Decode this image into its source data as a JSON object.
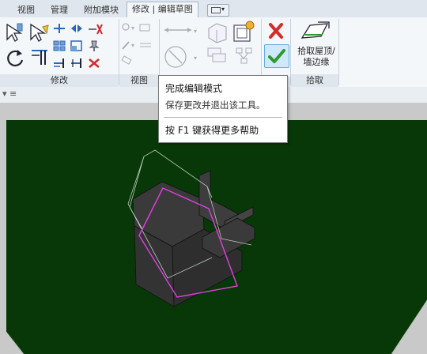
{
  "tabs": [
    {
      "label": "视图",
      "active": false
    },
    {
      "label": "管理",
      "active": false
    },
    {
      "label": "附加模块",
      "active": false
    },
    {
      "label": "修改 | 编辑草图",
      "active": true
    }
  ],
  "panels": {
    "modify": "修改",
    "view": "视图",
    "pick": "拾取"
  },
  "pick_roof_button": {
    "line1": "拾取屋顶/",
    "line2": "墙边缘"
  },
  "tooltip": {
    "title": "完成编辑模式",
    "description": "保存更改并退出该工具。",
    "help": "按 F1 键获得更多帮助"
  },
  "colors": {
    "viewport_bg": "#083808",
    "sketch_line": "#e040e0",
    "finish_check": "#2e9a2e",
    "cancel_x": "#d42c2c"
  }
}
